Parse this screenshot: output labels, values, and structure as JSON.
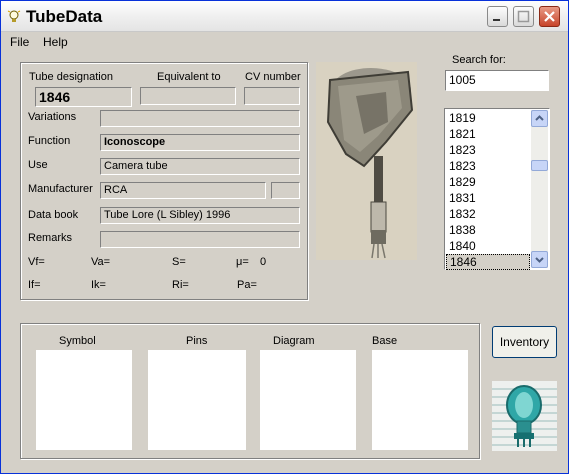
{
  "window": {
    "title": "TubeData",
    "controls": [
      "minimize-icon",
      "maximize-icon",
      "close-icon"
    ]
  },
  "menu": {
    "file": "File",
    "help": "Help"
  },
  "header_labels": {
    "tube_designation": "Tube designation",
    "equivalent_to": "Equivalent to",
    "cv_number": "CV number"
  },
  "fields": {
    "tube_designation": "1846",
    "equivalent_to": "",
    "cv_number": "",
    "variations": "",
    "function": "Iconoscope",
    "use": "Camera tube",
    "manufacturer": "RCA",
    "manufacturer_extra": "",
    "data_book": "Tube Lore (L Sibley) 1996",
    "remarks": ""
  },
  "field_labels": {
    "variations": "Variations",
    "function": "Function",
    "use": "Use",
    "manufacturer": "Manufacturer",
    "data_book": "Data book",
    "remarks": "Remarks"
  },
  "params": {
    "vf": "Vf=",
    "va": "Va=",
    "s": "S=",
    "mu": "μ=",
    "mu_value": "0",
    "if": "If=",
    "ik": "Ik=",
    "ri": "Ri=",
    "pa": "Pa="
  },
  "search": {
    "label": "Search for:",
    "value": "1005"
  },
  "list": {
    "items": [
      "1819",
      "1821",
      "1823",
      "1823",
      "1829",
      "1831",
      "1832",
      "1838",
      "1840",
      "1846"
    ],
    "selected": "1846"
  },
  "panels": {
    "symbol": "Symbol",
    "pins": "Pins",
    "diagram": "Diagram",
    "base": "Base"
  },
  "buttons": {
    "inventory": "Inventory"
  },
  "colors": {
    "face": "#d4d0c8",
    "close_button": "#c7442a"
  }
}
